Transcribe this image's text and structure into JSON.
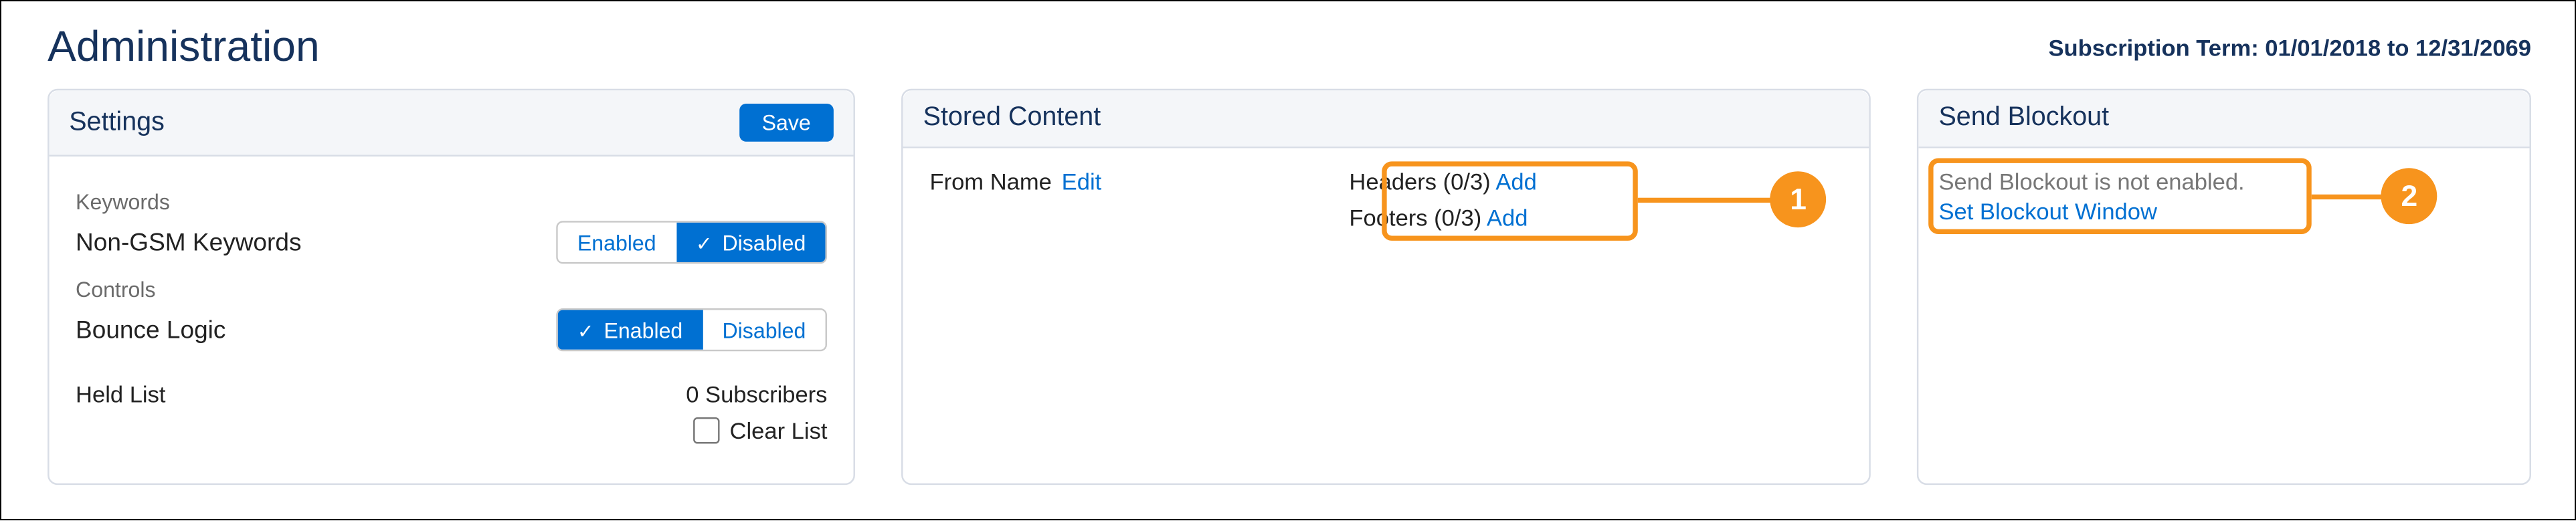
{
  "header": {
    "title": "Administration",
    "subscription_term": "Subscription Term: 01/01/2018 to 12/31/2069"
  },
  "settings": {
    "panel_title": "Settings",
    "save_label": "Save",
    "keywords_label": "Keywords",
    "nongsm_label": "Non-GSM Keywords",
    "nongsm_enabled": "Enabled",
    "nongsm_disabled": "Disabled",
    "nongsm_state": "disabled",
    "controls_label": "Controls",
    "bounce_label": "Bounce Logic",
    "bounce_enabled": "Enabled",
    "bounce_disabled": "Disabled",
    "bounce_state": "enabled",
    "held_label": "Held List",
    "held_value": "0 Subscribers",
    "clear_label": "Clear List"
  },
  "stored": {
    "panel_title": "Stored Content",
    "from_name_label": "From Name",
    "from_name_edit": "Edit",
    "headers_label": "Headers (0/3)",
    "headers_add": "Add",
    "footers_label": "Footers (0/3)",
    "footers_add": "Add",
    "callout_num": "1"
  },
  "blockout": {
    "panel_title": "Send Blockout",
    "status_text": "Send Blockout is not enabled.",
    "link_text": "Set Blockout Window",
    "callout_num": "2"
  }
}
